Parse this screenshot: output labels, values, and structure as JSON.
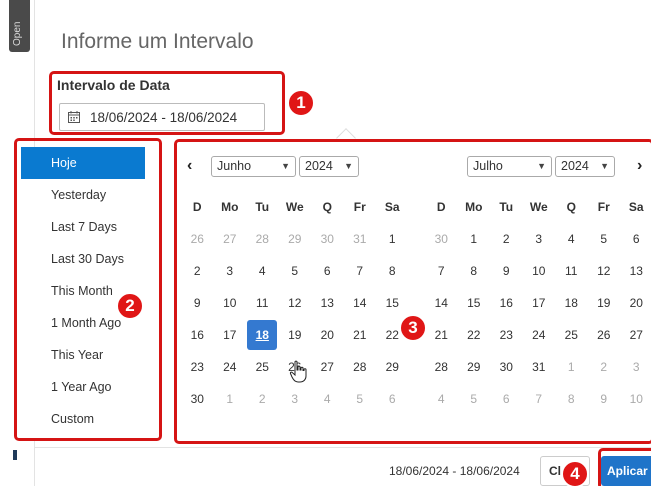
{
  "sidebar": {
    "open_tab_label": "Open"
  },
  "modal": {
    "title": "Informe um Intervalo"
  },
  "date_field": {
    "label": "Intervalo de Data",
    "value": "18/06/2024 - 18/06/2024"
  },
  "ranges": [
    {
      "label": "Hoje",
      "active": true
    },
    {
      "label": "Yesterday"
    },
    {
      "label": "Last 7 Days"
    },
    {
      "label": "Last 30 Days"
    },
    {
      "label": "This Month"
    },
    {
      "label": "1 Month Ago"
    },
    {
      "label": "This Year"
    },
    {
      "label": "1 Year Ago"
    },
    {
      "label": "Custom"
    }
  ],
  "weekdays": [
    "D",
    "Mo",
    "Tu",
    "We",
    "Q",
    "Fr",
    "Sa"
  ],
  "calendars": {
    "left": {
      "month": "Junho",
      "year": "2024",
      "weeks": [
        [
          "26",
          "27",
          "28",
          "29",
          "30",
          "31",
          "1"
        ],
        [
          "2",
          "3",
          "4",
          "5",
          "6",
          "7",
          "8"
        ],
        [
          "9",
          "10",
          "11",
          "12",
          "13",
          "14",
          "15"
        ],
        [
          "16",
          "17",
          "18",
          "19",
          "20",
          "21",
          "22"
        ],
        [
          "23",
          "24",
          "25",
          "26",
          "27",
          "28",
          "29"
        ],
        [
          "30",
          "1",
          "2",
          "3",
          "4",
          "5",
          "6"
        ]
      ]
    },
    "right": {
      "month": "Julho",
      "year": "2024",
      "weeks": [
        [
          "30",
          "1",
          "2",
          "3",
          "4",
          "5",
          "6"
        ],
        [
          "7",
          "8",
          "9",
          "10",
          "11",
          "12",
          "13"
        ],
        [
          "14",
          "15",
          "16",
          "17",
          "18",
          "19",
          "20"
        ],
        [
          "21",
          "22",
          "23",
          "24",
          "25",
          "26",
          "27"
        ],
        [
          "28",
          "29",
          "30",
          "31",
          "1",
          "2",
          "3"
        ],
        [
          "4",
          "5",
          "6",
          "7",
          "8",
          "9",
          "10"
        ]
      ]
    }
  },
  "footer": {
    "range_text": "18/06/2024 - 18/06/2024",
    "cancel_label": "Cl",
    "apply_label": "Aplicar"
  },
  "annotations": [
    "1",
    "2",
    "3",
    "4"
  ],
  "colors": {
    "accent": "#0a7ad0",
    "selected_day": "#3479d0",
    "annotation_red": "#d51414",
    "apply_button": "#1f74c9"
  }
}
